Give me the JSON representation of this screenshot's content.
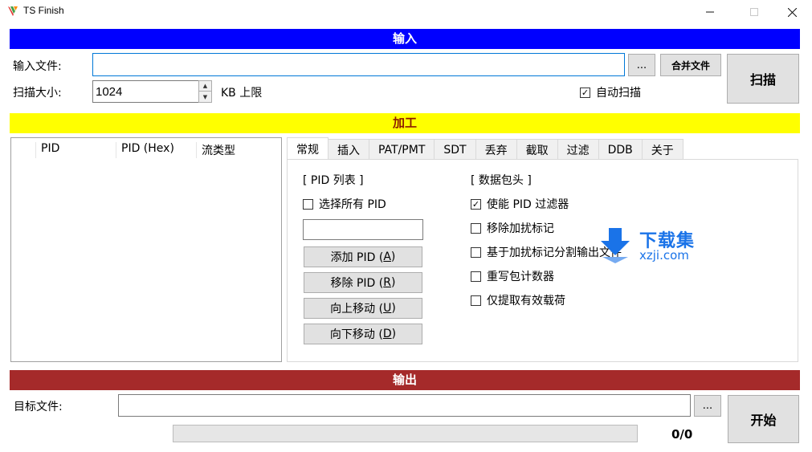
{
  "window": {
    "title": "TS Finish"
  },
  "sections": {
    "input": "输入",
    "process": "加工",
    "output": "输出"
  },
  "input": {
    "file_label": "输入文件:",
    "file_value": "",
    "browse_label": "...",
    "merge_label": "合并文件",
    "scan_size_label": "扫描大小:",
    "scan_size_value": "1024",
    "scan_unit": "KB 上限",
    "auto_scan_label": "自动扫描",
    "auto_scan_checked": true,
    "scan_button": "扫描"
  },
  "pid_table": {
    "columns": [
      "PID",
      "PID (Hex)",
      "流类型"
    ],
    "rows": []
  },
  "tabs": [
    "常规",
    "插入",
    "PAT/PMT",
    "SDT",
    "丢弃",
    "截取",
    "过滤",
    "DDB",
    "关于"
  ],
  "active_tab": "常规",
  "general": {
    "pid_list_title": "[ PID 列表 ]",
    "select_all": "选择所有 PID",
    "select_all_checked": false,
    "pid_input_value": "",
    "buttons": {
      "add": {
        "pre": "添加 PID (",
        "key": "A",
        "post": ")"
      },
      "remove": {
        "pre": "移除 PID (",
        "key": "R",
        "post": ")"
      },
      "up": {
        "pre": "向上移动 (",
        "key": "U",
        "post": ")"
      },
      "down": {
        "pre": "向下移动 (",
        "key": "D",
        "post": ")"
      }
    },
    "header_title": "[ 数据包头 ]",
    "options": [
      {
        "label": "使能 PID 过滤器",
        "checked": true
      },
      {
        "label": "移除加扰标记",
        "checked": false
      },
      {
        "label": "基于加扰标记分割输出文件",
        "checked": false
      },
      {
        "label": "重写包计数器",
        "checked": false
      },
      {
        "label": "仅提取有效载荷",
        "checked": false
      }
    ]
  },
  "output": {
    "target_label": "目标文件:",
    "target_value": "",
    "browse_label": "...",
    "start_button": "开始",
    "progress_fraction": 0,
    "progress_text": "0/0"
  },
  "watermark": {
    "cn": "下载集",
    "domain": "xzji.com"
  },
  "colors": {
    "input_bar": "#0000ff",
    "process_bar": "#ffff00",
    "output_bar": "#a52a2a"
  }
}
